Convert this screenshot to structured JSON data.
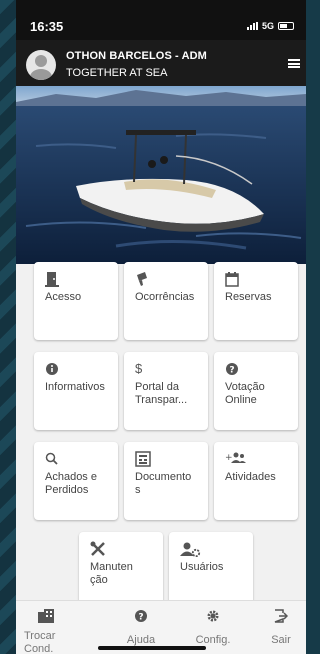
{
  "status": {
    "time": "16:35",
    "network": "5G"
  },
  "header": {
    "name": "OTHON BARCELOS - ADM",
    "subtitle": "TOGETHER AT SEA"
  },
  "cards": [
    {
      "label": "Acesso",
      "icon": "door-icon"
    },
    {
      "label": "Ocorrências",
      "icon": "megaphone-icon"
    },
    {
      "label": "Reservas",
      "icon": "calendar-icon"
    },
    {
      "label": "Informativos",
      "icon": "info-icon"
    },
    {
      "label": "Portal da Transpar...",
      "icon": "dollar-icon"
    },
    {
      "label": "Votação Online",
      "icon": "question-icon"
    },
    {
      "label": "Achados e Perdidos",
      "icon": "search-icon"
    },
    {
      "label": "Documentos",
      "icon": "document-icon"
    },
    {
      "label": "Atividades",
      "icon": "group-icon"
    },
    {
      "label": "Manutenção",
      "icon": "tools-icon"
    },
    {
      "label": "Usuários",
      "icon": "users-gear-icon"
    }
  ],
  "tabs": [
    {
      "label": "Trocar Cond.",
      "icon": "building-icon"
    },
    {
      "label": "Ajuda",
      "icon": "help-icon"
    },
    {
      "label": "Config.",
      "icon": "gear-icon"
    },
    {
      "label": "Sair",
      "icon": "logout-icon"
    }
  ]
}
